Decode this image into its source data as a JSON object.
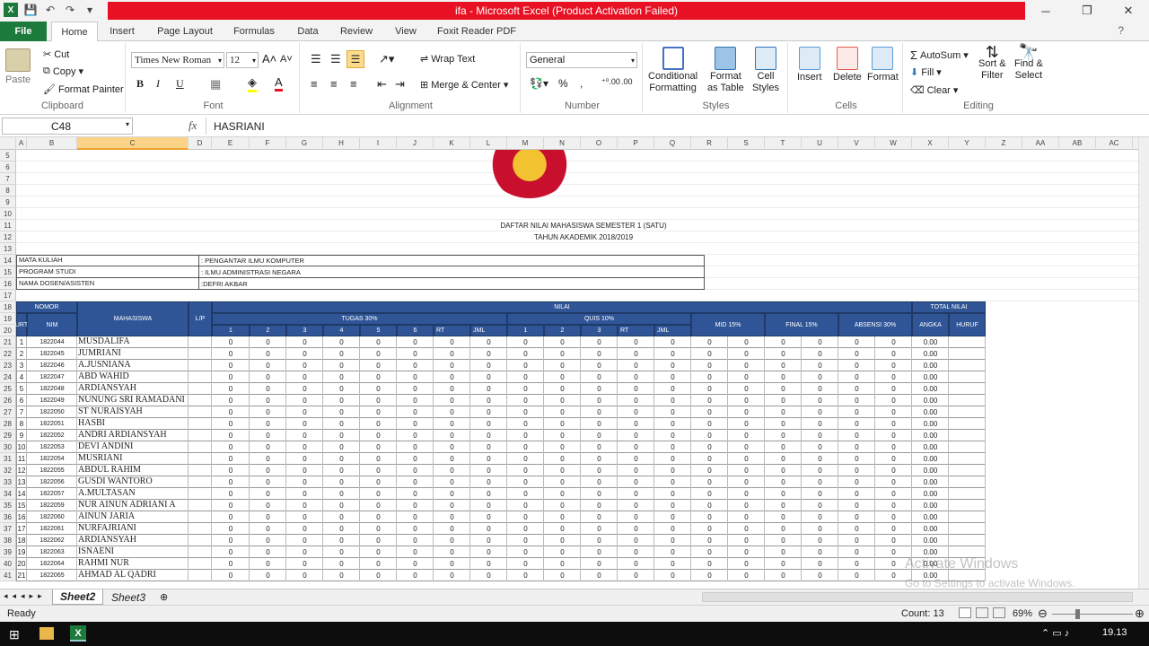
{
  "window": {
    "title": "ifa  -  Microsoft Excel (Product Activation Failed)",
    "controls": [
      "─",
      "❐",
      "✕"
    ]
  },
  "tabs": [
    "File",
    "Home",
    "Insert",
    "Page Layout",
    "Formulas",
    "Data",
    "Review",
    "View",
    "Foxit Reader PDF"
  ],
  "ribbon": {
    "clipboard": {
      "paste": "Paste",
      "cut": "Cut",
      "copy": "Copy",
      "format_painter": "Format Painter",
      "label": "Clipboard"
    },
    "font": {
      "name": "Times New Roman",
      "size": "12",
      "label": "Font"
    },
    "alignment": {
      "wrap": "Wrap Text",
      "merge": "Merge & Center",
      "label": "Alignment"
    },
    "number": {
      "format": "General",
      "label": "Number"
    },
    "styles": {
      "conditional": [
        "Conditional",
        "Formatting"
      ],
      "table": [
        "Format",
        "as Table"
      ],
      "cell": [
        "Cell",
        "Styles"
      ],
      "label": "Styles"
    },
    "cells": {
      "insert": "Insert",
      "delete": "Delete",
      "format": "Format",
      "label": "Cells"
    },
    "editing": {
      "autosum": "AutoSum",
      "fill": "Fill",
      "clear": "Clear",
      "sort": [
        "Sort &",
        "Filter"
      ],
      "find": [
        "Find &",
        "Select"
      ],
      "label": "Editing"
    }
  },
  "formula_bar": {
    "cell_ref": "C48",
    "fx": "fx",
    "value": "HASRIANI"
  },
  "columns": [
    "A",
    "B",
    "C",
    "D",
    "E",
    "F",
    "G",
    "H",
    "I",
    "J",
    "K",
    "L",
    "M",
    "N",
    "O",
    "P",
    "Q",
    "R",
    "S",
    "T",
    "U",
    "V",
    "W",
    "X",
    "Y",
    "Z",
    "AA",
    "AB",
    "AC"
  ],
  "rows": [
    "5",
    "6",
    "7",
    "8",
    "9",
    "10",
    "11",
    "12",
    "13",
    "14",
    "15",
    "16",
    "17",
    "18",
    "19",
    "20",
    "21",
    "22",
    "23",
    "24",
    "25",
    "26",
    "27",
    "28",
    "29",
    "30",
    "31",
    "32",
    "33",
    "34",
    "35",
    "36",
    "37",
    "38",
    "39",
    "40",
    "41"
  ],
  "sheet": {
    "heading1": "DAFTAR NILAI MAHASISWA SEMESTER 1 (SATU)",
    "heading2": "TAHUN AKADEMIK 2018/2019",
    "info": [
      {
        "label": "MATA KULIAH",
        "value": ": PENGANTAR ILMU KOMPUTER"
      },
      {
        "label": "PROGRAM STUDI",
        "value": ": ILMU ADMINISTRASI NEGARA"
      },
      {
        "label": "NAMA DOSEN/ASISTEN",
        "value": ":DEFRI AKBAR"
      }
    ],
    "hdr": {
      "nomor": "NOMOR",
      "urt": "URT",
      "nim": "NIM",
      "mahasiswa": "MAHASISWA",
      "lp": "L/P",
      "nilai": "NILAI",
      "tugas": "TUGAS 30%",
      "quis": "QUIS 10%",
      "mid": "MID 15%",
      "final": "FINAL 15%",
      "absensi": "ABSENSI 30%",
      "total": "TOTAL NILAI",
      "angka": "ANGKA",
      "huruf": "HURUF",
      "sub_tugas": [
        "1",
        "2",
        "3",
        "4",
        "5",
        "6",
        "RT",
        "JML"
      ],
      "sub_quis": [
        "1",
        "2",
        "3",
        "RT",
        "JML"
      ]
    },
    "students": [
      {
        "no": "1",
        "nim": "1822044",
        "name": "MUSDALIFA"
      },
      {
        "no": "2",
        "nim": "1822045",
        "name": "JUMRIANI"
      },
      {
        "no": "3",
        "nim": "1822046",
        "name": "A.JUSNIANA"
      },
      {
        "no": "4",
        "nim": "1822047",
        "name": "ABD WAHID"
      },
      {
        "no": "5",
        "nim": "1822048",
        "name": "ARDIANSYAH"
      },
      {
        "no": "6",
        "nim": "1822049",
        "name": "NUNUNG SRI RAMADANI"
      },
      {
        "no": "7",
        "nim": "1822050",
        "name": "ST NURAISYAH"
      },
      {
        "no": "8",
        "nim": "1822051",
        "name": "HASBI"
      },
      {
        "no": "9",
        "nim": "1822052",
        "name": "ANDRI ARDIANSYAH"
      },
      {
        "no": "10",
        "nim": "1822053",
        "name": "DEVI ANDINI"
      },
      {
        "no": "11",
        "nim": "1822054",
        "name": "MUSRIANI"
      },
      {
        "no": "12",
        "nim": "1822055",
        "name": "ABDUL RAHIM"
      },
      {
        "no": "13",
        "nim": "1822056",
        "name": "GUSDI WANTORO"
      },
      {
        "no": "14",
        "nim": "1822057",
        "name": "A.MULTASAN"
      },
      {
        "no": "15",
        "nim": "1822059",
        "name": "NUR AINUN ADRIANI A"
      },
      {
        "no": "16",
        "nim": "1822060",
        "name": "AINUN JARIA"
      },
      {
        "no": "17",
        "nim": "1822061",
        "name": "NURFAJRIANI"
      },
      {
        "no": "18",
        "nim": "1822062",
        "name": "ARDIANSYAH"
      },
      {
        "no": "19",
        "nim": "1822063",
        "name": "ISNAENI"
      },
      {
        "no": "20",
        "nim": "1822064",
        "name": "RAHMI NUR"
      },
      {
        "no": "21",
        "nim": "1822065",
        "name": "AHMAD AL QADRI"
      }
    ],
    "zero": "0",
    "angka": "0.00"
  },
  "sheet_tabs": [
    "Sheet2",
    "Sheet3"
  ],
  "status": {
    "ready": "Ready",
    "count": "Count: 13",
    "zoom": "69%"
  },
  "watermark": {
    "line1": "Activate Windows",
    "line2": "Go to Settings to activate Windows."
  },
  "taskbar": {
    "time": "19.13"
  },
  "colors": {
    "excel_green": "#1d7a3d",
    "title_red": "#e81123",
    "header_blue": "#2f5597"
  }
}
